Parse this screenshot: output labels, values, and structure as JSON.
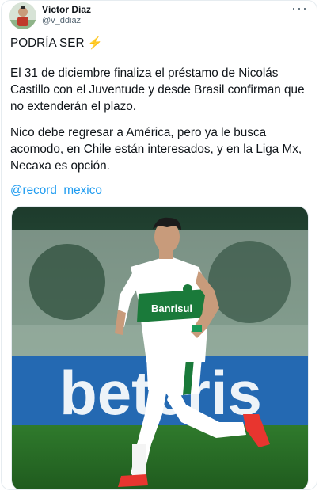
{
  "tweet": {
    "author_name": "Víctor Díaz",
    "author_handle": "@v_ddiaz",
    "more_icon": "more-horizontal-icon",
    "headline": "PODRÍA SER",
    "headline_emoji": "⚡",
    "paragraph_1": "El 31 de diciembre finaliza el préstamo de Nicolás Castillo con el Juventude y desde Brasil confirman que no extenderán el plazo.",
    "paragraph_2": "Nico debe regresar a América, pero ya le busca acomodo, en Chile están interesados, y en la Liga Mx, Necaxa es opción.",
    "mention": "@record_mexico"
  },
  "media": {
    "banner_text": "betcris",
    "jersey_sponsor": "Banrisul",
    "colors": {
      "jersey": "#ffffff",
      "accent": "#1a7a3a",
      "boots": "#e8352f",
      "mention": "#1d9bf0"
    }
  }
}
